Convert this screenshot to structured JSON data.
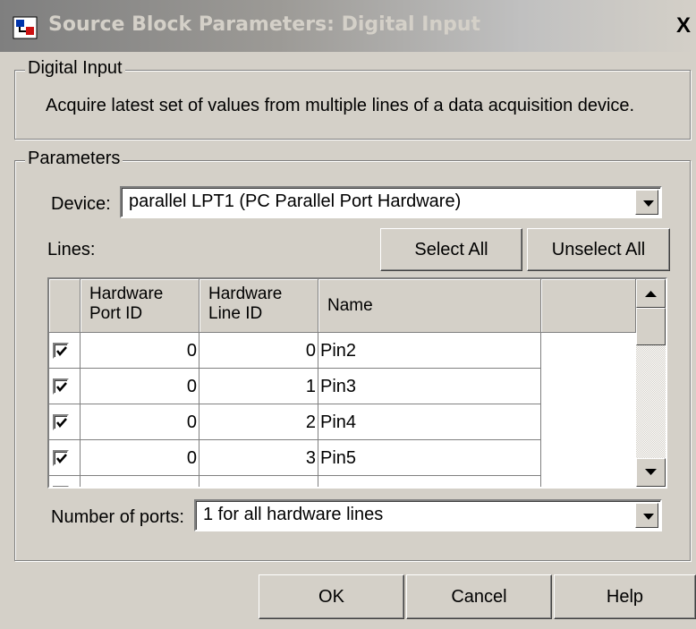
{
  "window": {
    "title": "Source Block Parameters: Digital Input",
    "close_label": "X"
  },
  "description_group": {
    "legend": "Digital Input",
    "text": "Acquire latest set of values from multiple lines of a data acquisition device."
  },
  "parameters": {
    "legend": "Parameters",
    "device_label": "Device:",
    "device_value": "parallel LPT1 (PC Parallel Port Hardware)",
    "lines_label": "Lines:",
    "select_all_label": "Select All",
    "unselect_all_label": "Unselect All",
    "table": {
      "headers": [
        "",
        "Hardware Port ID",
        "Hardware Line ID",
        "Name"
      ],
      "rows": [
        {
          "checked": true,
          "port_id": "0",
          "line_id": "0",
          "name": "Pin2"
        },
        {
          "checked": true,
          "port_id": "0",
          "line_id": "1",
          "name": "Pin3"
        },
        {
          "checked": true,
          "port_id": "0",
          "line_id": "2",
          "name": "Pin4"
        },
        {
          "checked": true,
          "port_id": "0",
          "line_id": "3",
          "name": "Pin5"
        }
      ]
    },
    "ports_label": "Number of ports:",
    "ports_value": "1 for all hardware lines"
  },
  "buttons": {
    "ok_label": "OK",
    "cancel_label": "Cancel",
    "help_label": "Help"
  }
}
